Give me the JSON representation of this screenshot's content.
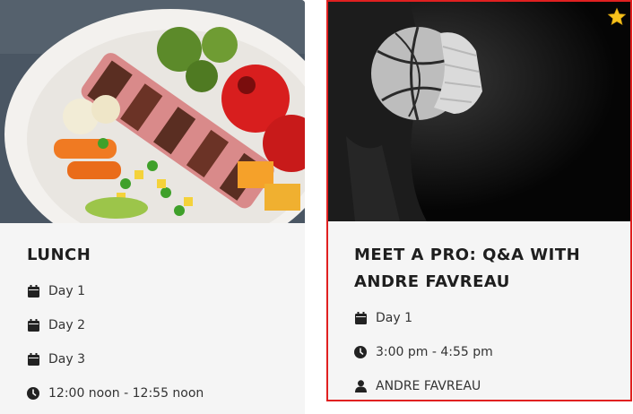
{
  "cards": [
    {
      "title": "LUNCH",
      "image_subject": "grilled meat skewer with vegetables",
      "meta": [
        {
          "icon": "calendar-icon",
          "text": "Day 1"
        },
        {
          "icon": "calendar-icon",
          "text": "Day 2"
        },
        {
          "icon": "calendar-icon",
          "text": "Day 3"
        },
        {
          "icon": "clock-icon",
          "text": "12:00 noon - 12:55 noon"
        }
      ]
    },
    {
      "title": "MEET A PRO: Q&A WITH ANDRE FAVREAU",
      "image_subject": "person holding a basketball",
      "favorite": true,
      "meta": [
        {
          "icon": "calendar-icon",
          "text": "Day 1"
        },
        {
          "icon": "clock-icon",
          "text": "3:00 pm - 4:55 pm"
        },
        {
          "icon": "user-icon",
          "text": "ANDRE FAVREAU"
        }
      ]
    }
  ],
  "colors": {
    "selected_border": "#e02020",
    "card_bg": "#f5f5f5",
    "star": "#f6c21c"
  }
}
